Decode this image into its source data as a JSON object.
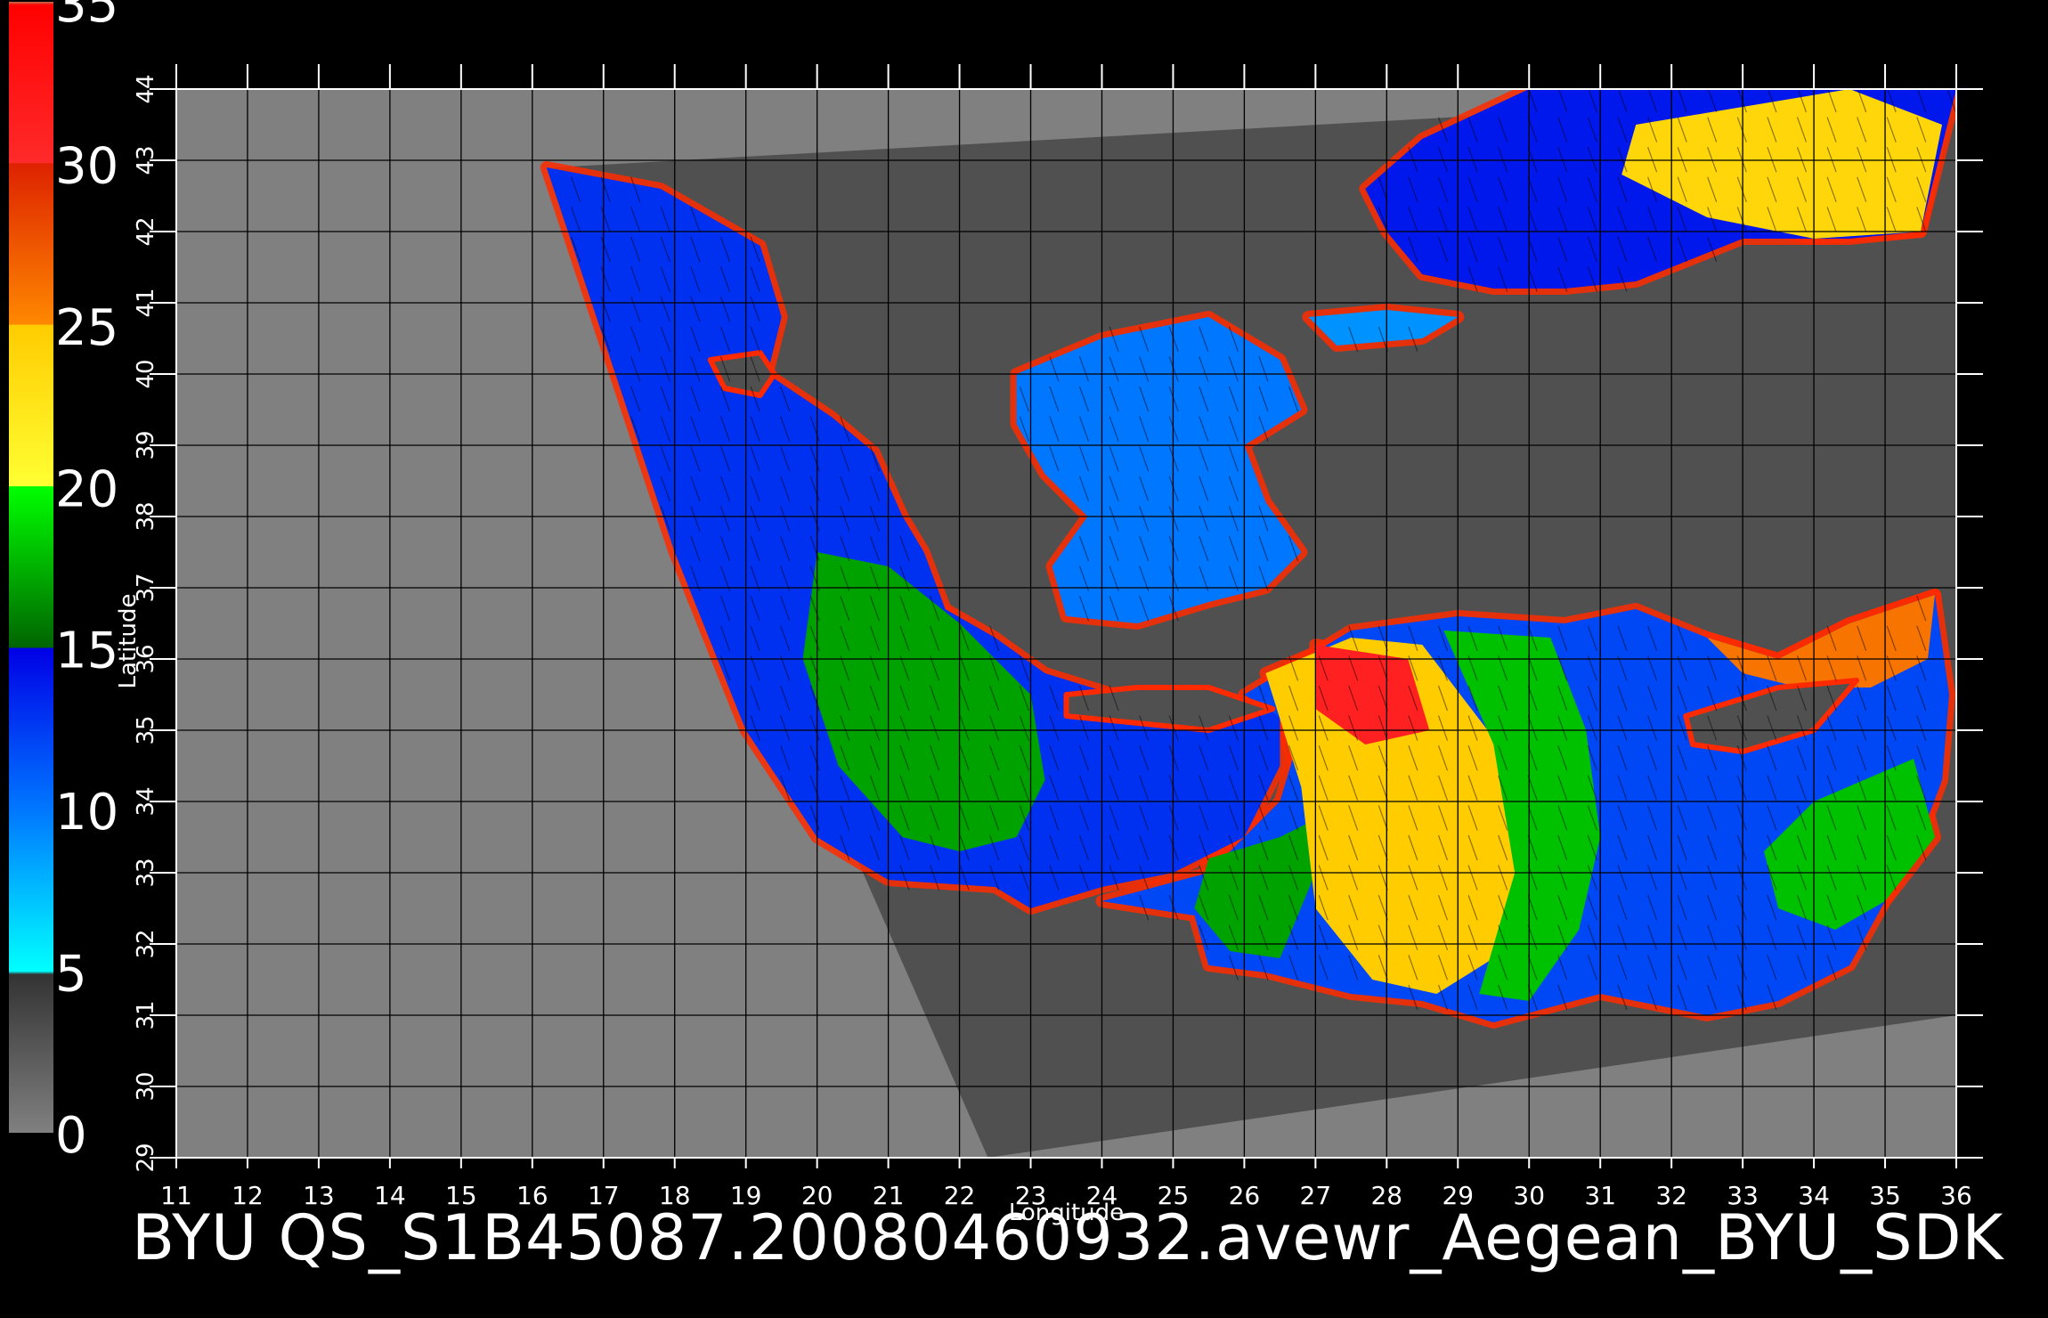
{
  "caption": "BYU  QS_S1B45087.20080460932.avewr_Aegean_BYU_SDK",
  "colors": {
    "background": "#000000",
    "outside_swath": "#808080",
    "no_data_in_swath": "#505050",
    "grid": "#000000",
    "land_fringe": "#ff2a00"
  },
  "colorbar": {
    "ticks": [
      "0",
      "5",
      "10",
      "15",
      "20",
      "25",
      "30",
      "35"
    ],
    "stops": [
      {
        "value": 0,
        "color": "#808080"
      },
      {
        "value": 4.9,
        "color": "#333333"
      },
      {
        "value": 5,
        "color": "#00ffff"
      },
      {
        "value": 10,
        "color": "#0077ff"
      },
      {
        "value": 15,
        "color": "#0000e6"
      },
      {
        "value": 15.01,
        "color": "#006400"
      },
      {
        "value": 20,
        "color": "#00ff00"
      },
      {
        "value": 20.01,
        "color": "#ffff33"
      },
      {
        "value": 25,
        "color": "#ffcc00"
      },
      {
        "value": 25.01,
        "color": "#ff8800"
      },
      {
        "value": 30,
        "color": "#dd2200"
      },
      {
        "value": 30.01,
        "color": "#ff2a2a"
      },
      {
        "value": 34.9,
        "color": "#ff0000"
      },
      {
        "value": 35,
        "color": "#c07050"
      }
    ]
  },
  "chart_data": {
    "type": "heatmap",
    "xlabel": "Longitude",
    "ylabel": "Latitude",
    "xlim": [
      11,
      36
    ],
    "ylim": [
      29,
      44
    ],
    "xticks": [
      "11",
      "12",
      "13",
      "14",
      "15",
      "16",
      "17",
      "18",
      "19",
      "20",
      "21",
      "22",
      "23",
      "24",
      "25",
      "26",
      "27",
      "28",
      "29",
      "30",
      "31",
      "32",
      "33",
      "34",
      "35",
      "36"
    ],
    "yticks": [
      "29",
      "30",
      "31",
      "32",
      "33",
      "34",
      "35",
      "36",
      "37",
      "38",
      "39",
      "40",
      "41",
      "42",
      "43",
      "44"
    ],
    "grid": true,
    "value_range": [
      0,
      35
    ],
    "swath_corners": [
      [
        16.3,
        42.9
      ],
      [
        36.0,
        44.0
      ],
      [
        36.0,
        31.0
      ],
      [
        22.4,
        29.0
      ]
    ],
    "sea_regions": [
      {
        "name": "central_mediterranean",
        "value": 13,
        "polygon": [
          [
            16.2,
            42.9
          ],
          [
            17.8,
            42.6
          ],
          [
            19.2,
            41.8
          ],
          [
            19.5,
            40.8
          ],
          [
            19.3,
            40.0
          ],
          [
            20.2,
            39.4
          ],
          [
            20.8,
            38.9
          ],
          [
            21.2,
            38.0
          ],
          [
            21.5,
            37.5
          ],
          [
            21.8,
            36.7
          ],
          [
            22.5,
            36.3
          ],
          [
            23.2,
            35.8
          ],
          [
            24.5,
            35.4
          ],
          [
            25.5,
            35.2
          ],
          [
            26.5,
            35.4
          ],
          [
            26.5,
            34.5
          ],
          [
            26.0,
            33.5
          ],
          [
            25.0,
            33.0
          ],
          [
            24.0,
            32.8
          ],
          [
            23.0,
            32.5
          ],
          [
            22.5,
            32.8
          ],
          [
            21.0,
            32.9
          ],
          [
            20.0,
            33.5
          ],
          [
            19.0,
            35.0
          ],
          [
            18.0,
            37.5
          ],
          [
            17.0,
            40.5
          ]
        ]
      },
      {
        "name": "ionian_green_band",
        "value": 17,
        "polygon": [
          [
            20.0,
            37.5
          ],
          [
            21.0,
            37.3
          ],
          [
            22.0,
            36.5
          ],
          [
            23.0,
            35.5
          ],
          [
            23.2,
            34.3
          ],
          [
            22.8,
            33.5
          ],
          [
            22.0,
            33.3
          ],
          [
            21.2,
            33.5
          ],
          [
            20.3,
            34.5
          ],
          [
            19.8,
            36.0
          ]
        ]
      },
      {
        "name": "aegean",
        "value": 10,
        "polygon": [
          [
            22.8,
            40.0
          ],
          [
            24.0,
            40.5
          ],
          [
            25.5,
            40.8
          ],
          [
            26.5,
            40.2
          ],
          [
            26.8,
            39.5
          ],
          [
            26.0,
            39.0
          ],
          [
            26.3,
            38.2
          ],
          [
            26.8,
            37.5
          ],
          [
            26.3,
            37.0
          ],
          [
            25.5,
            36.8
          ],
          [
            24.5,
            36.5
          ],
          [
            23.5,
            36.6
          ],
          [
            23.3,
            37.3
          ],
          [
            23.8,
            38.0
          ],
          [
            23.2,
            38.6
          ],
          [
            22.8,
            39.3
          ]
        ]
      },
      {
        "name": "black_sea",
        "value": 14,
        "polygon": [
          [
            27.7,
            42.6
          ],
          [
            28.5,
            43.3
          ],
          [
            30.0,
            44.0
          ],
          [
            36.0,
            44.0
          ],
          [
            35.5,
            42.0
          ],
          [
            34.5,
            41.9
          ],
          [
            33.0,
            41.9
          ],
          [
            31.5,
            41.3
          ],
          [
            30.5,
            41.2
          ],
          [
            29.5,
            41.2
          ],
          [
            28.5,
            41.4
          ],
          [
            28.0,
            42.0
          ]
        ]
      },
      {
        "name": "black_sea_east_warm",
        "value": 24,
        "polygon": [
          [
            31.5,
            43.5
          ],
          [
            34.5,
            44.0
          ],
          [
            35.8,
            43.5
          ],
          [
            35.5,
            42.0
          ],
          [
            34.0,
            41.9
          ],
          [
            32.5,
            42.2
          ],
          [
            31.3,
            42.8
          ]
        ]
      },
      {
        "name": "marmara",
        "value": 9,
        "polygon": [
          [
            26.9,
            40.8
          ],
          [
            28.0,
            40.9
          ],
          [
            29.0,
            40.8
          ],
          [
            28.5,
            40.5
          ],
          [
            27.3,
            40.4
          ]
        ]
      },
      {
        "name": "eastern_mediterranean",
        "value": 12,
        "polygon": [
          [
            26.0,
            35.5
          ],
          [
            27.5,
            36.4
          ],
          [
            29.0,
            36.6
          ],
          [
            30.5,
            36.5
          ],
          [
            31.5,
            36.7
          ],
          [
            32.5,
            36.3
          ],
          [
            33.5,
            36.0
          ],
          [
            34.5,
            36.5
          ],
          [
            35.7,
            36.9
          ],
          [
            35.9,
            35.5
          ],
          [
            35.8,
            34.3
          ],
          [
            35.5,
            33.5
          ],
          [
            35.0,
            32.6
          ],
          [
            34.5,
            31.7
          ],
          [
            33.5,
            31.2
          ],
          [
            32.5,
            31.0
          ],
          [
            31.0,
            31.3
          ],
          [
            29.5,
            30.9
          ],
          [
            28.5,
            31.2
          ],
          [
            27.5,
            31.3
          ],
          [
            26.3,
            31.6
          ],
          [
            25.5,
            31.7
          ],
          [
            25.3,
            32.4
          ],
          [
            24.0,
            32.6
          ],
          [
            25.5,
            33.0
          ],
          [
            26.5,
            34.0
          ],
          [
            26.8,
            35.0
          ]
        ]
      },
      {
        "name": "eastern_med_west_green",
        "value": 17,
        "polygon": [
          [
            25.5,
            33.2
          ],
          [
            26.5,
            33.5
          ],
          [
            27.5,
            34.0
          ],
          [
            27.0,
            33.0
          ],
          [
            26.5,
            31.8
          ],
          [
            25.8,
            31.9
          ],
          [
            25.3,
            32.5
          ]
        ]
      },
      {
        "name": "warm_band",
        "value": 25,
        "polygon": [
          [
            26.3,
            35.8
          ],
          [
            27.5,
            36.3
          ],
          [
            28.5,
            36.2
          ],
          [
            29.8,
            34.5
          ],
          [
            30.0,
            33.0
          ],
          [
            29.5,
            31.8
          ],
          [
            28.7,
            31.3
          ],
          [
            27.8,
            31.5
          ],
          [
            27.0,
            32.5
          ],
          [
            26.8,
            34.2
          ]
        ]
      },
      {
        "name": "warm_band_core",
        "value": 31,
        "polygon": [
          [
            27.0,
            36.2
          ],
          [
            28.3,
            36.0
          ],
          [
            28.6,
            35.0
          ],
          [
            27.7,
            34.8
          ],
          [
            27.0,
            35.3
          ]
        ]
      },
      {
        "name": "green_mid_east",
        "value": 18,
        "polygon": [
          [
            28.8,
            36.4
          ],
          [
            30.3,
            36.3
          ],
          [
            30.8,
            35.0
          ],
          [
            31.0,
            33.5
          ],
          [
            30.7,
            32.2
          ],
          [
            30.0,
            31.2
          ],
          [
            29.3,
            31.3
          ],
          [
            29.8,
            33.0
          ],
          [
            29.5,
            34.8
          ]
        ]
      },
      {
        "name": "levant_green",
        "value": 18,
        "polygon": [
          [
            34.0,
            34.0
          ],
          [
            35.4,
            34.6
          ],
          [
            35.7,
            33.5
          ],
          [
            35.0,
            32.6
          ],
          [
            34.3,
            32.2
          ],
          [
            33.5,
            32.5
          ],
          [
            33.3,
            33.3
          ]
        ]
      },
      {
        "name": "cilicia_warm",
        "value": 26,
        "polygon": [
          [
            32.5,
            36.3
          ],
          [
            33.5,
            36.0
          ],
          [
            34.5,
            36.5
          ],
          [
            35.7,
            36.9
          ],
          [
            35.6,
            36.0
          ],
          [
            34.8,
            35.6
          ],
          [
            33.8,
            35.6
          ],
          [
            33.0,
            35.8
          ]
        ]
      }
    ],
    "islands": [
      {
        "name": "sicily",
        "polygon": [
          [
            18.5,
            40.2
          ],
          [
            19.2,
            40.3
          ],
          [
            19.4,
            40.0
          ],
          [
            19.2,
            39.7
          ],
          [
            18.7,
            39.8
          ]
        ]
      },
      {
        "name": "crete",
        "polygon": [
          [
            23.5,
            35.5
          ],
          [
            24.5,
            35.6
          ],
          [
            25.5,
            35.6
          ],
          [
            26.4,
            35.3
          ],
          [
            25.5,
            35.0
          ],
          [
            24.5,
            35.1
          ],
          [
            23.5,
            35.2
          ]
        ]
      },
      {
        "name": "cyprus",
        "polygon": [
          [
            32.2,
            35.2
          ],
          [
            33.5,
            35.6
          ],
          [
            34.6,
            35.7
          ],
          [
            34.0,
            35.0
          ],
          [
            33.0,
            34.7
          ],
          [
            32.3,
            34.8
          ]
        ]
      }
    ]
  }
}
